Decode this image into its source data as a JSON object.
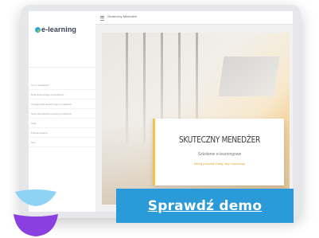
{
  "app": {
    "logo_text": "e-learning"
  },
  "topbar": {
    "course_title": "Skuteczny Menedżer"
  },
  "sidebar": {
    "items": [
      "Co to menedżer?",
      "Rola skutecznego menedżera?",
      "Umiejętności skutecznego menedżera",
      "Style zarządzania w pracy menedżera",
      "Cele",
      "Podsumowanie",
      "Test"
    ]
  },
  "slide": {
    "title": "SKUTECZNY MENEDŻER",
    "subtitle": "Szkolenie e-learningowe",
    "cta_text": "Kliknij przycisk Dalej, aby rozpocząć"
  },
  "cta": {
    "label": "Sprawdź demo"
  },
  "colors": {
    "accent_blue": "#2b9ad8",
    "accent_yellow": "#f6c14b",
    "brand_light_blue": "#8fd3f4",
    "brand_purple": "#8b3fe0"
  }
}
